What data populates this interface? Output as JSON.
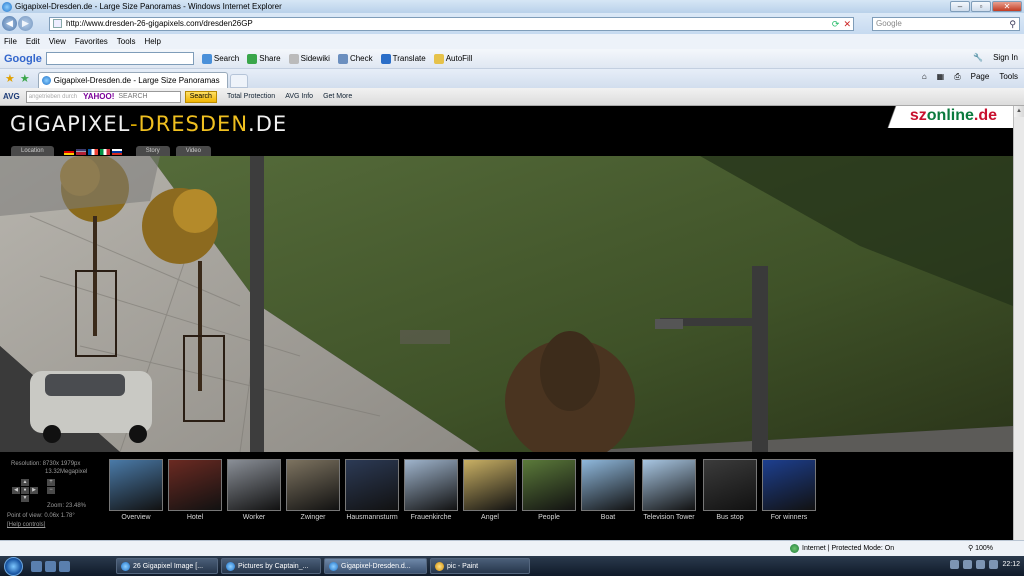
{
  "window": {
    "title": "Gigapixel-Dresden.de - Large Size Panoramas - Windows Internet Explorer",
    "controls": [
      "–",
      "▫",
      "✕"
    ]
  },
  "address": {
    "url": "http://www.dresden-26-gigapixels.com/dresden26GP",
    "search_placeholder": "Google"
  },
  "menu": [
    "File",
    "Edit",
    "View",
    "Favorites",
    "Tools",
    "Help"
  ],
  "google_toolbar": {
    "logo": "Google",
    "items": [
      "Search",
      "Share",
      "Sidewiki",
      "Check",
      "Translate",
      "AutoFill"
    ],
    "sign_in": "Sign In"
  },
  "tabs": {
    "active": "Gigapixel-Dresden.de - Large Size Panoramas",
    "commands": [
      "Page",
      "Tools"
    ]
  },
  "avg_toolbar": {
    "logo": "AVG",
    "yahoo_hint": "angetrieben durch",
    "yahoo_logo": "YAHOO!",
    "yahoo_label": "SEARCH",
    "search_button": "Search",
    "items": [
      "Total Protection",
      "AVG Info",
      "Get More"
    ]
  },
  "site": {
    "logo_left": "GIGAPIXEL",
    "logo_dash": "-",
    "logo_mid": "DRESDEN",
    "logo_right": ".DE",
    "partner_a": "sz",
    "partner_b": "online",
    "partner_c": ".de",
    "tab_location": "Location",
    "tab_story": "Story",
    "tab_video": "Video",
    "info": {
      "resolution": "Resolution: 8730x 1979px",
      "megapixel": "13.32Megapixel",
      "zoom": "Zoom: 23.48%",
      "point_of_view": "Point of view: 0.06x 1.78°",
      "help": "[Help controls]"
    },
    "thumbnails": [
      {
        "label": "Overview",
        "color": "#4a7aa8"
      },
      {
        "label": "Hotel",
        "color": "#6b2a22"
      },
      {
        "label": "Worker",
        "color": "#8a8f97"
      },
      {
        "label": "Zwinger",
        "color": "#7d7360"
      },
      {
        "label": "Hausmannsturm",
        "color": "#2c3a55"
      },
      {
        "label": "Frauenkirche",
        "color": "#9fb4cc"
      },
      {
        "label": "Angel",
        "color": "#c9b064"
      },
      {
        "label": "People",
        "color": "#5b7a3a"
      },
      {
        "label": "Boat",
        "color": "#8fb8dc"
      },
      {
        "label": "Television Tower",
        "color": "#a8c6e2"
      },
      {
        "label": "Bus stop",
        "color": "#3b3b3b"
      },
      {
        "label": "For winners",
        "color": "#1d3f8f"
      }
    ]
  },
  "status": {
    "zone": "Internet | Protected Mode: On",
    "zoom": "100%"
  },
  "taskbar": {
    "tasks": [
      "26 Gigapixel Image [...",
      "Pictures by Captain_...",
      "Gigapixel-Dresden.d...",
      "pic - Paint"
    ],
    "clock": "22:12"
  }
}
